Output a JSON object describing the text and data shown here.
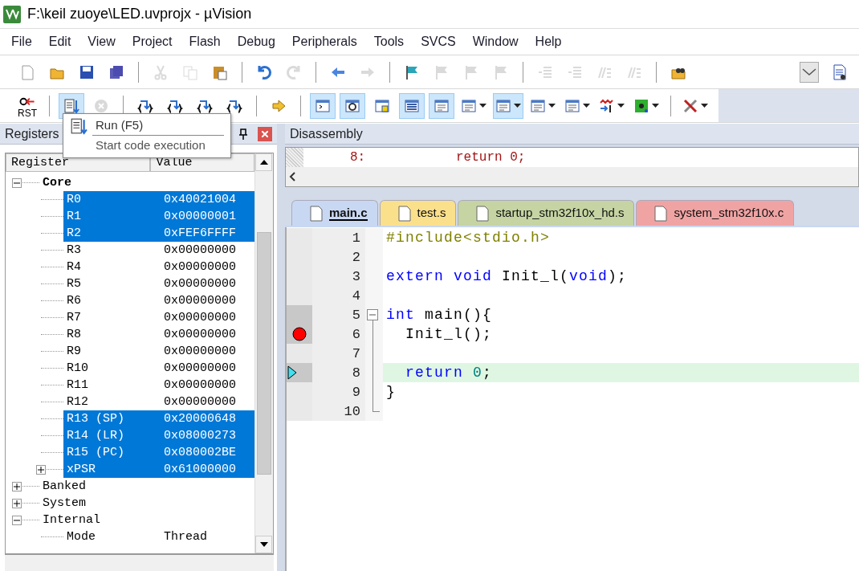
{
  "window": {
    "title": "F:\\keil zuoye\\LED.uvprojx - µVision"
  },
  "menu": [
    "File",
    "Edit",
    "View",
    "Project",
    "Flash",
    "Debug",
    "Peripherals",
    "Tools",
    "SVCS",
    "Window",
    "Help"
  ],
  "toolbar_file": {
    "left": [
      {
        "kind": "button",
        "disabled": false
      },
      {
        "kind": "button",
        "disabled": false
      },
      {
        "kind": "button",
        "disabled": false
      },
      {
        "kind": "button",
        "disabled": false
      },
      {
        "kind": "separator"
      },
      {
        "kind": "button",
        "disabled": true
      },
      {
        "kind": "button",
        "disabled": true
      },
      {
        "kind": "button",
        "disabled": false
      },
      {
        "kind": "separator"
      },
      {
        "kind": "button",
        "disabled": false
      },
      {
        "kind": "button",
        "disabled": true
      },
      {
        "kind": "separator"
      },
      {
        "kind": "button",
        "disabled": false
      },
      {
        "kind": "button",
        "disabled": true
      },
      {
        "kind": "separator"
      },
      {
        "kind": "button",
        "disabled": false
      },
      {
        "kind": "button",
        "disabled": true
      },
      {
        "kind": "button",
        "disabled": true
      },
      {
        "kind": "button",
        "disabled": true
      },
      {
        "kind": "separator"
      },
      {
        "kind": "button",
        "disabled": true
      },
      {
        "kind": "button",
        "disabled": true
      },
      {
        "kind": "button",
        "disabled": true
      },
      {
        "kind": "button",
        "disabled": true
      },
      {
        "kind": "separator"
      },
      {
        "kind": "button",
        "disabled": false
      }
    ],
    "right": [
      {
        "kind": "combo",
        "disabled": false
      },
      {
        "kind": "button",
        "disabled": false
      }
    ]
  },
  "toolbar_debug": [
    {
      "kind": "labeled",
      "label": "RST",
      "disabled": false,
      "pressed": false
    },
    {
      "kind": "separator"
    },
    {
      "kind": "button",
      "disabled": false,
      "pressed": true
    },
    {
      "kind": "button",
      "disabled": true,
      "pressed": false
    },
    {
      "kind": "separator"
    },
    {
      "kind": "button",
      "disabled": false,
      "pressed": false
    },
    {
      "kind": "button",
      "disabled": false,
      "pressed": false
    },
    {
      "kind": "button",
      "disabled": false,
      "pressed": false
    },
    {
      "kind": "button",
      "disabled": false,
      "pressed": false
    },
    {
      "kind": "separator"
    },
    {
      "kind": "button",
      "disabled": false,
      "pressed": false
    },
    {
      "kind": "separator"
    },
    {
      "kind": "button",
      "disabled": false,
      "pressed": true
    },
    {
      "kind": "button",
      "disabled": false,
      "pressed": true
    },
    {
      "kind": "button",
      "disabled": false,
      "pressed": false
    },
    {
      "kind": "button",
      "disabled": false,
      "pressed": true
    },
    {
      "kind": "button",
      "disabled": false,
      "pressed": true
    },
    {
      "kind": "dropdown",
      "disabled": false,
      "pressed": false
    },
    {
      "kind": "dropdown",
      "disabled": false,
      "pressed": true
    },
    {
      "kind": "dropdown",
      "disabled": false,
      "pressed": false
    },
    {
      "kind": "dropdown",
      "disabled": false,
      "pressed": false
    },
    {
      "kind": "dropdown",
      "disabled": false,
      "pressed": false
    },
    {
      "kind": "dropdown",
      "disabled": false,
      "pressed": false
    },
    {
      "kind": "separator"
    },
    {
      "kind": "dropdown",
      "disabled": false,
      "pressed": false
    }
  ],
  "tooltip": {
    "title": "Run (F5)",
    "description": "Start code execution"
  },
  "registers_panel": {
    "title": "Registers",
    "columns": [
      "Register",
      "Value"
    ],
    "tree": [
      {
        "kind": "node",
        "name": "Core",
        "bold": true,
        "expanded": true,
        "selected": false,
        "children": [
          {
            "kind": "leaf",
            "name": "R0",
            "value": "0x40021004",
            "selected": true
          },
          {
            "kind": "leaf",
            "name": "R1",
            "value": "0x00000001",
            "selected": true
          },
          {
            "kind": "leaf",
            "name": "R2",
            "value": "0xFEF6FFFF",
            "selected": true
          },
          {
            "kind": "leaf",
            "name": "R3",
            "value": "0x00000000",
            "selected": false
          },
          {
            "kind": "leaf",
            "name": "R4",
            "value": "0x00000000",
            "selected": false
          },
          {
            "kind": "leaf",
            "name": "R5",
            "value": "0x00000000",
            "selected": false
          },
          {
            "kind": "leaf",
            "name": "R6",
            "value": "0x00000000",
            "selected": false
          },
          {
            "kind": "leaf",
            "name": "R7",
            "value": "0x00000000",
            "selected": false
          },
          {
            "kind": "leaf",
            "name": "R8",
            "value": "0x00000000",
            "selected": false
          },
          {
            "kind": "leaf",
            "name": "R9",
            "value": "0x00000000",
            "selected": false
          },
          {
            "kind": "leaf",
            "name": "R10",
            "value": "0x00000000",
            "selected": false
          },
          {
            "kind": "leaf",
            "name": "R11",
            "value": "0x00000000",
            "selected": false
          },
          {
            "kind": "leaf",
            "name": "R12",
            "value": "0x00000000",
            "selected": false
          },
          {
            "kind": "leaf",
            "name": "R13 (SP)",
            "value": "0x20000648",
            "selected": true
          },
          {
            "kind": "leaf",
            "name": "R14 (LR)",
            "value": "0x08000273",
            "selected": true
          },
          {
            "kind": "leaf",
            "name": "R15 (PC)",
            "value": "0x080002BE",
            "selected": true
          },
          {
            "kind": "node",
            "name": "xPSR",
            "value": "0x61000000",
            "bold": false,
            "expanded": false,
            "selected": true
          }
        ]
      },
      {
        "kind": "node",
        "name": "Banked",
        "bold": false,
        "expanded": false,
        "selected": false
      },
      {
        "kind": "node",
        "name": "System",
        "bold": false,
        "expanded": false,
        "selected": false
      },
      {
        "kind": "node",
        "name": "Internal",
        "bold": false,
        "expanded": true,
        "selected": false,
        "children": [
          {
            "kind": "leaf",
            "name": "Mode",
            "value": "Thread",
            "selected": false
          }
        ]
      }
    ]
  },
  "disassembly": {
    "title": "Disassembly",
    "lines": [
      {
        "address": "8:",
        "code": "return 0;"
      }
    ]
  },
  "editor_tabs": [
    {
      "label": "main.c",
      "color": "#c9d8f2",
      "selected": true
    },
    {
      "label": "test.s",
      "color": "#fbe08c",
      "selected": false
    },
    {
      "label": "startup_stm32f10x_hd.s",
      "color": "#c5d4a2",
      "selected": false
    },
    {
      "label": "system_stm32f10x.c",
      "color": "#f0a3a3",
      "selected": false
    }
  ],
  "code_lines": [
    {
      "number": "1",
      "kind": "plain",
      "executable": false,
      "breakpoint": false,
      "current": false,
      "tokens": [
        {
          "kind": "pre",
          "text": "#include<stdio.h>"
        }
      ]
    },
    {
      "number": "2",
      "kind": "plain",
      "executable": false,
      "breakpoint": false,
      "current": false
    },
    {
      "number": "3",
      "kind": "plain",
      "executable": false,
      "breakpoint": false,
      "current": false,
      "tokens": [
        {
          "kind": "kw",
          "text": "extern"
        },
        {
          "kind": "kw",
          "text": " void"
        },
        {
          "kind": "text",
          "text": " Init_l("
        },
        {
          "kind": "kw",
          "text": "void"
        },
        {
          "kind": "text",
          "text": ");"
        }
      ]
    },
    {
      "number": "4",
      "kind": "plain",
      "executable": false,
      "breakpoint": false,
      "current": false
    },
    {
      "number": "5",
      "kind": "fold-start",
      "executable": true,
      "breakpoint": false,
      "current": false,
      "tokens": [
        {
          "kind": "kw",
          "text": "int"
        },
        {
          "kind": "text",
          "text": " main(){"
        }
      ]
    },
    {
      "number": "6",
      "kind": "fold-body",
      "executable": true,
      "breakpoint": true,
      "current": false,
      "tokens": [
        {
          "kind": "text",
          "text": "  Init_l();"
        }
      ]
    },
    {
      "number": "7",
      "kind": "fold-body",
      "executable": false,
      "breakpoint": false,
      "current": false
    },
    {
      "number": "8",
      "kind": "fold-body",
      "executable": true,
      "breakpoint": false,
      "current": true,
      "tokens": [
        {
          "kind": "kw",
          "text": "  return"
        },
        {
          "kind": "num",
          "text": " 0"
        },
        {
          "kind": "text",
          "text": ";"
        }
      ]
    },
    {
      "number": "9",
      "kind": "fold-body",
      "executable": false,
      "breakpoint": false,
      "current": false,
      "tokens": [
        {
          "kind": "text",
          "text": "}"
        }
      ]
    },
    {
      "number": "10",
      "kind": "fold-end",
      "executable": false,
      "breakpoint": false,
      "current": false
    }
  ]
}
